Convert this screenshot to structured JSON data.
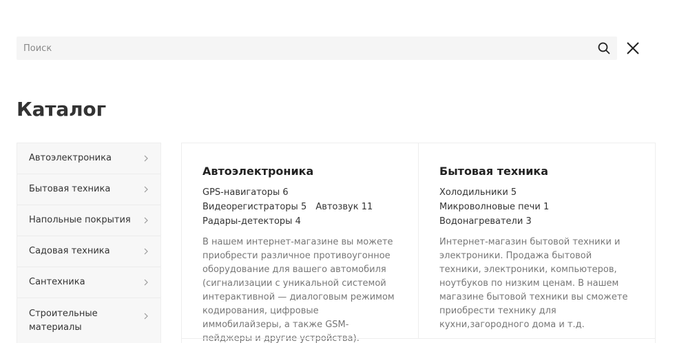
{
  "search": {
    "placeholder": "Поиск"
  },
  "page": {
    "title": "Каталог"
  },
  "sidebar": {
    "items": [
      {
        "label": "Автоэлектроника"
      },
      {
        "label": "Бытовая техника"
      },
      {
        "label": "Напольные покрытия"
      },
      {
        "label": "Садовая техника"
      },
      {
        "label": "Сантехника"
      },
      {
        "label": "Строительные материалы"
      }
    ]
  },
  "catalog": {
    "cards": [
      {
        "title": "Автоэлектроника",
        "subcategories": [
          {
            "name": "GPS-навигаторы",
            "count": "6"
          },
          {
            "name": "Видеорегистраторы",
            "count": "5"
          },
          {
            "name": "Автозвук",
            "count": "11"
          },
          {
            "name": "Радары-детекторы",
            "count": "4"
          }
        ],
        "description": "В нашем интернет-магазине вы можете приобрести различное противоугонное оборудование для вашего автомобиля (сигнализации с уникальной системой интерактивной — диалоговым режимом кодирования, цифровые иммобилайзеры, а также GSM-пейджеры и другие устройства)."
      },
      {
        "title": "Бытовая техника",
        "subcategories": [
          {
            "name": "Холодильники",
            "count": "5"
          },
          {
            "name": "Микроволновые печи",
            "count": "1"
          },
          {
            "name": "Водонагреватели",
            "count": "3"
          }
        ],
        "description": "Интернет-магазин бытовой техники и электроники. Продажа бытовой техники, электроники, компьютеров, ноутбуков по низким ценам. В нашем магазине бытовой техники вы сможете приобрести технику для кухни,загородного дома и т.д."
      }
    ]
  },
  "icons": {
    "search": "search-icon",
    "close": "close-icon",
    "chevron": "chevron-right-icon"
  }
}
